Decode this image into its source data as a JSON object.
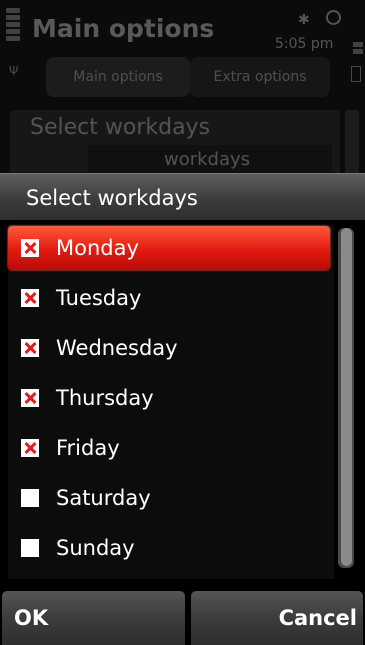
{
  "background": {
    "title": "Main options",
    "time": "5:05 pm",
    "tabs": [
      "Main options",
      "Extra options"
    ],
    "panel_title": "Select workdays",
    "panel_value": "workdays"
  },
  "dialog": {
    "title": "Select workdays",
    "items": [
      {
        "label": "Monday",
        "checked": true,
        "selected": true
      },
      {
        "label": "Tuesday",
        "checked": true,
        "selected": false
      },
      {
        "label": "Wednesday",
        "checked": true,
        "selected": false
      },
      {
        "label": "Thursday",
        "checked": true,
        "selected": false
      },
      {
        "label": "Friday",
        "checked": true,
        "selected": false
      },
      {
        "label": "Saturday",
        "checked": false,
        "selected": false
      },
      {
        "label": "Sunday",
        "checked": false,
        "selected": false
      }
    ]
  },
  "softkeys": {
    "left": "OK",
    "right": "Cancel"
  },
  "colors": {
    "highlight": "#e01a10",
    "check_mark": "#e31b1b"
  }
}
